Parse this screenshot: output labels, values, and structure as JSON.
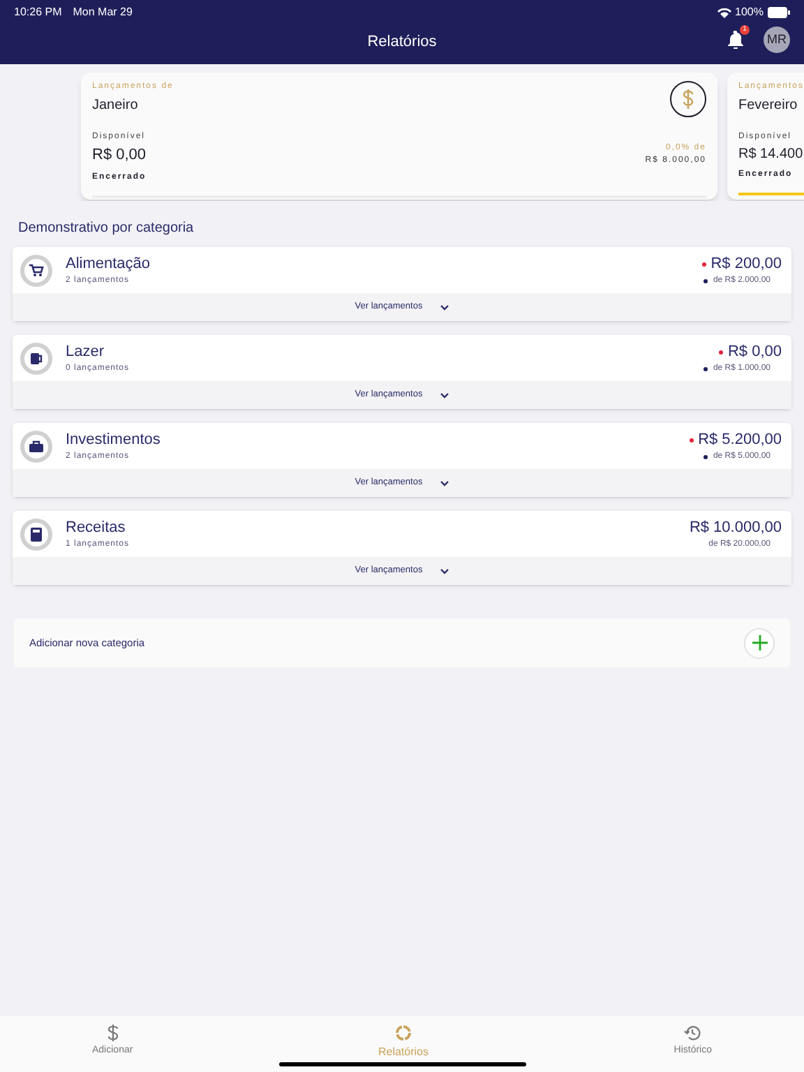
{
  "status_bar": {
    "time": "10:26 PM",
    "date": "Mon Mar 29",
    "battery": "100%"
  },
  "header": {
    "title": "Relatórios",
    "notification_count": "1",
    "avatar": "MR"
  },
  "months": [
    {
      "caption": "Lançamentos de",
      "month": "Janeiro",
      "available_label": "Disponível",
      "available": "R$ 0,00",
      "status": "Encerrado",
      "percent": "0,0% de",
      "total": "R$ 8.000,00",
      "level": 0
    },
    {
      "caption": "Lançamentos",
      "month": "Fevereiro",
      "available_label": "Disponível",
      "available": "R$ 14.400",
      "status": "Encerrado",
      "level": 1
    }
  ],
  "section_title": "Demonstrativo por categoria",
  "categories": [
    {
      "name": "Alimentação",
      "count": "2 lançamentos",
      "amount": "R$ 200,00",
      "limit": "de R$ 2.000,00",
      "alert": true,
      "toggle": "Ver lançamentos"
    },
    {
      "name": "Lazer",
      "count": "0 lançamentos",
      "amount": "R$ 0,00",
      "limit": "de R$ 1.000,00",
      "alert": true,
      "toggle": "Ver lançamentos"
    },
    {
      "name": "Investimentos",
      "count": "2 lançamentos",
      "amount": "R$ 5.200,00",
      "limit": "de R$ 5.000,00",
      "alert": true,
      "toggle": "Ver lançamentos"
    },
    {
      "name": "Receitas",
      "count": "1 lançamentos",
      "amount": "R$ 10.000,00",
      "limit": "de R$ 20.000,00",
      "alert": false,
      "toggle": "Ver lançamentos"
    }
  ],
  "add_category": {
    "label": "Adicionar nova categoria"
  },
  "tabs": [
    {
      "label": "Adicionar",
      "selected": false
    },
    {
      "label": "Relatórios",
      "selected": true
    },
    {
      "label": "Histórico",
      "selected": false
    }
  ]
}
